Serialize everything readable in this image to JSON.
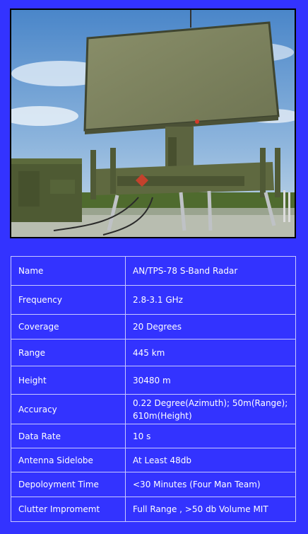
{
  "image": {
    "subject": "radar-photo",
    "colors": {
      "background": "#3333ff",
      "table_border": "#c8c8ff",
      "text": "#ffffff"
    }
  },
  "specs": [
    {
      "label": "Name",
      "value": "AN/TPS-78 S-Band Radar"
    },
    {
      "label": "Frequency",
      "value": "2.8-3.1 GHz"
    },
    {
      "label": "Coverage",
      "value": "20 Degrees"
    },
    {
      "label": "Range",
      "value": "445 km"
    },
    {
      "label": "Height",
      "value": "30480 m"
    },
    {
      "label": "Accuracy",
      "value": "0.22 Degree(Azimuth);  50m(Range); 610m(Height)"
    },
    {
      "label": "Data Rate",
      "value": "10 s"
    },
    {
      "label": "Antenna Sidelobe",
      "value": "At Least 48db"
    },
    {
      "label": "Depoloyment Time",
      "value": "<30 Minutes (Four Man Team)"
    },
    {
      "label": "Clutter Impromemt",
      "value": "Full Range , >50 db Volume MIT"
    }
  ]
}
